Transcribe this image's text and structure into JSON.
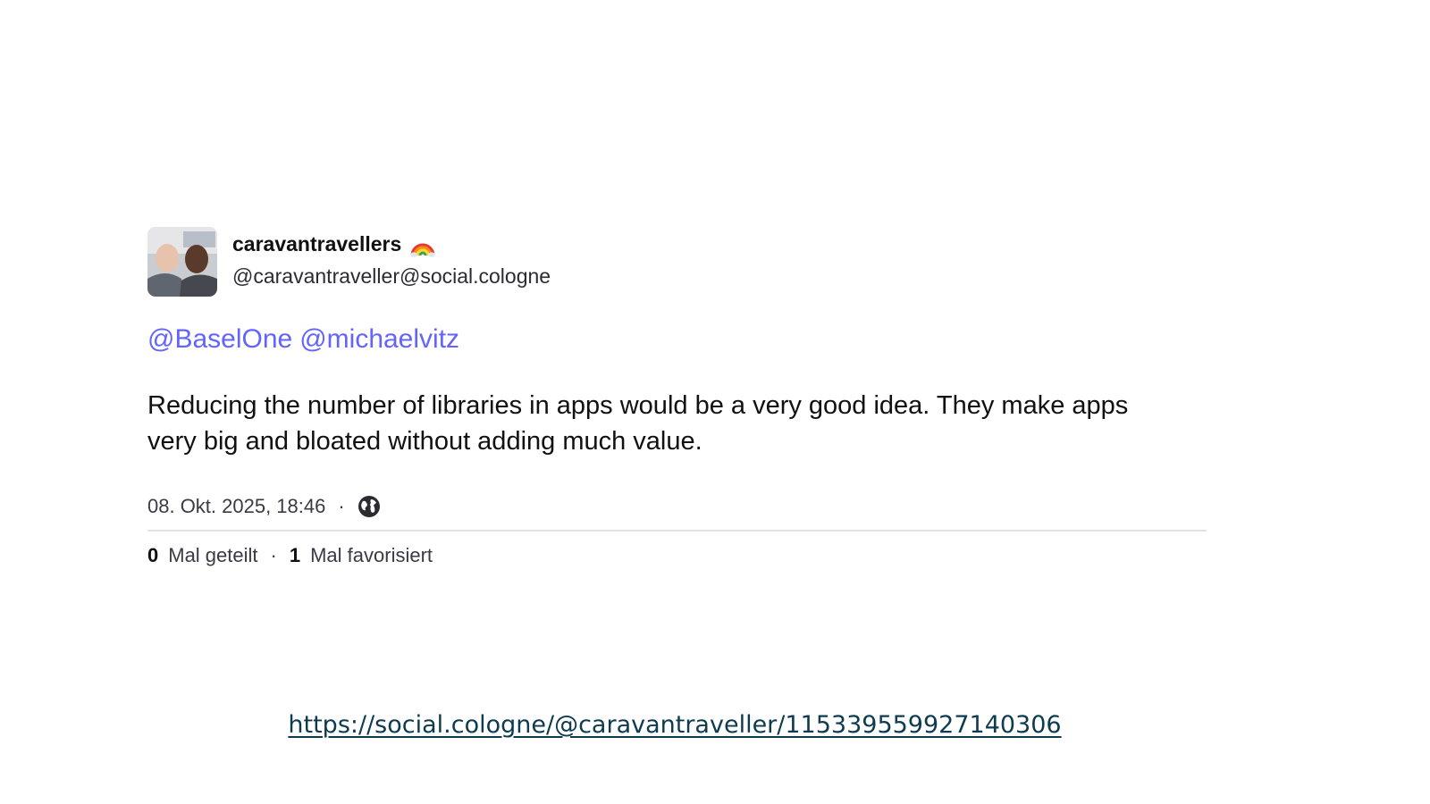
{
  "post": {
    "avatar_icon": "profile-photo-two-men",
    "display_name": "caravantravellers",
    "name_emoji_icon": "rainbow-icon",
    "handle": "@caravantraveller@social.cologne",
    "mentions": [
      "@BaselOne",
      "@michaelvitz"
    ],
    "content": "Reducing the number of libraries in apps would be a very good idea. They make apps very big and bloated without adding much value.",
    "timestamp": "08. Okt. 2025, 18:46",
    "separator": "·",
    "visibility_icon": "globe-icon",
    "stats": {
      "boost_count": "0",
      "boost_label": "Mal geteilt",
      "favourite_count": "1",
      "favourite_label": "Mal favorisiert"
    }
  },
  "link": {
    "url": "https://social.cologne/@caravantraveller/115339559927140306"
  },
  "colors": {
    "mention": "#6364ff",
    "link": "#0d3b4f",
    "text": "#111111",
    "divider": "#e2e1ea"
  }
}
